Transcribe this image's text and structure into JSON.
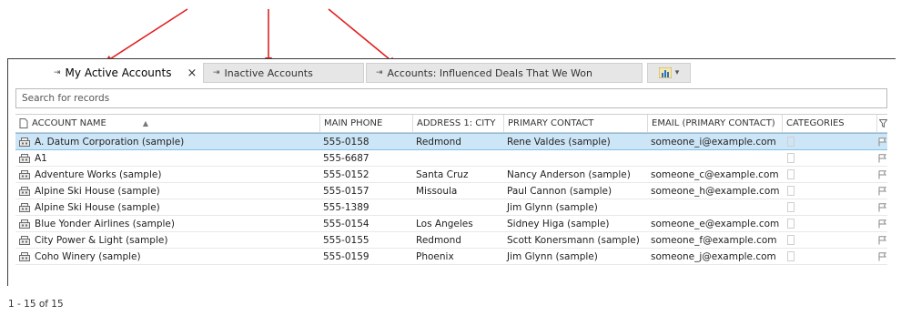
{
  "tabs": [
    {
      "label": "My Active Accounts",
      "active": true,
      "has_close": true
    },
    {
      "label": "Inactive Accounts",
      "active": false
    },
    {
      "label": "Accounts: Influenced Deals That We Won",
      "active": false
    }
  ],
  "tab_close_symbol": "×",
  "chart_button": {
    "icon": "chart-icon",
    "caret": "▾"
  },
  "search": {
    "placeholder": "Search for records"
  },
  "grid": {
    "columns": {
      "name": "ACCOUNT NAME",
      "phone": "MAIN PHONE",
      "city": "ADDRESS 1: CITY",
      "contact": "PRIMARY CONTACT",
      "email": "EMAIL (PRIMARY CONTACT)",
      "categories": "CATEGORIES"
    },
    "rows": [
      {
        "name": "A. Datum Corporation (sample)",
        "phone": "555-0158",
        "city": "Redmond",
        "contact": "Rene Valdes (sample)",
        "email": "someone_i@example.com",
        "selected": true
      },
      {
        "name": "A1",
        "phone": "555-6687",
        "city": "",
        "contact": "",
        "email": ""
      },
      {
        "name": "Adventure Works (sample)",
        "phone": "555-0152",
        "city": "Santa Cruz",
        "contact": "Nancy Anderson (sample)",
        "email": "someone_c@example.com"
      },
      {
        "name": "Alpine Ski House (sample)",
        "phone": "555-0157",
        "city": "Missoula",
        "contact": "Paul Cannon (sample)",
        "email": "someone_h@example.com"
      },
      {
        "name": "Alpine Ski House (sample)",
        "phone": "555-1389",
        "city": "",
        "contact": "Jim Glynn (sample)",
        "email": ""
      },
      {
        "name": "Blue Yonder Airlines (sample)",
        "phone": "555-0154",
        "city": "Los Angeles",
        "contact": "Sidney Higa (sample)",
        "email": "someone_e@example.com"
      },
      {
        "name": "City Power & Light (sample)",
        "phone": "555-0155",
        "city": "Redmond",
        "contact": "Scott Konersmann (sample)",
        "email": "someone_f@example.com"
      },
      {
        "name": "Coho Winery (sample)",
        "phone": "555-0159",
        "city": "Phoenix",
        "contact": "Jim Glynn (sample)",
        "email": "someone_j@example.com"
      }
    ]
  },
  "pager": {
    "text": "1 - 15 of 15"
  },
  "colors": {
    "arrow": "#e02020",
    "selected_row": "#cde6f7",
    "tab_inactive": "#e6e6e6"
  }
}
